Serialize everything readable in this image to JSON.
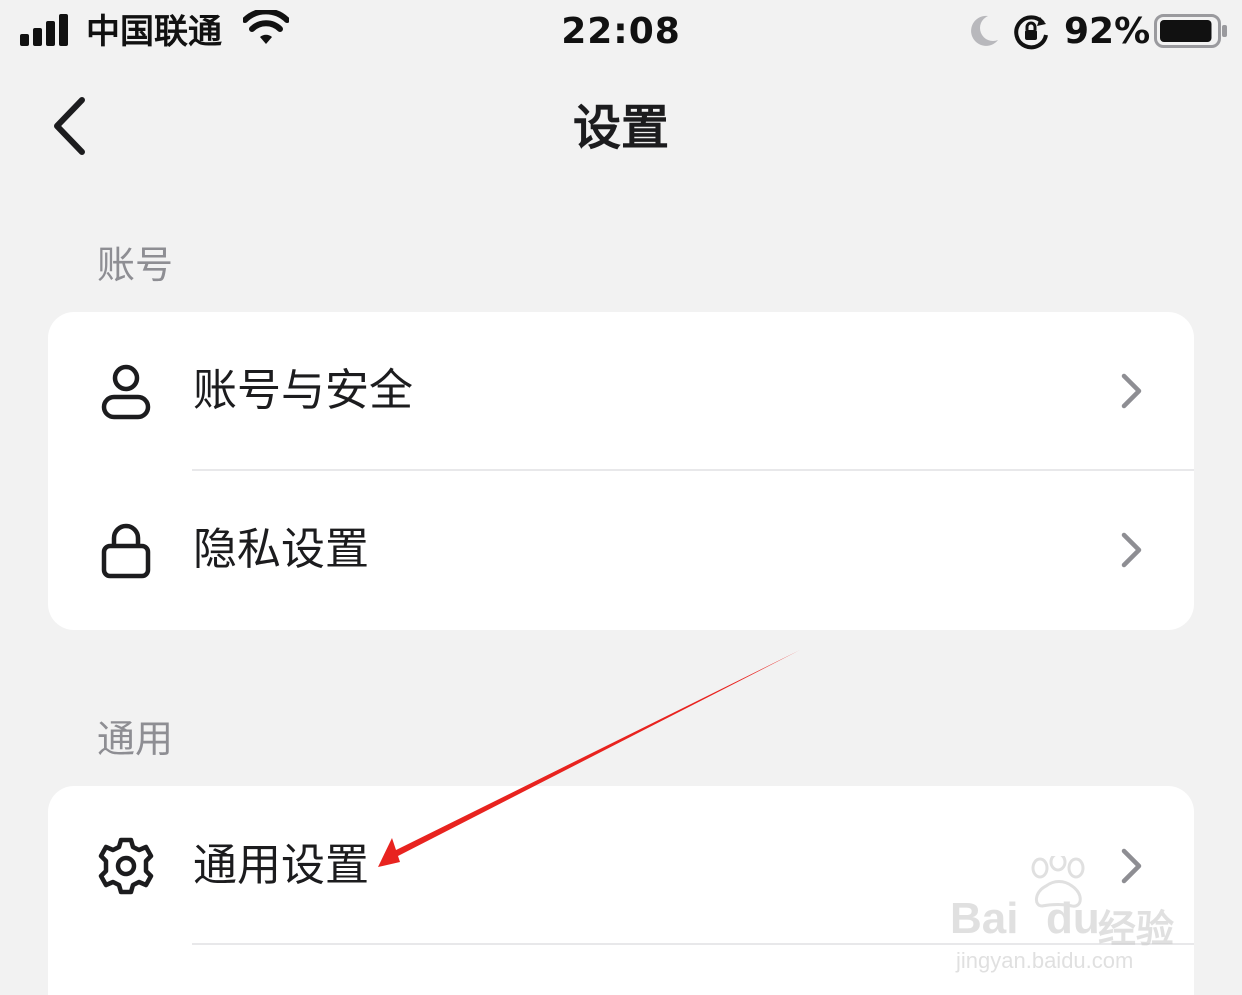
{
  "status_bar": {
    "carrier": "中国联通",
    "time": "22:08",
    "battery_percent": "92%",
    "battery_level": 0.92,
    "icons": [
      "signal-icon",
      "wifi-icon",
      "moon-icon",
      "rotation-lock-icon",
      "battery-icon"
    ]
  },
  "nav": {
    "title": "设置",
    "back_icon": "chevron-left-icon"
  },
  "sections": [
    {
      "header": "账号",
      "items": [
        {
          "label": "账号与安全",
          "icon": "user-icon"
        },
        {
          "label": "隐私设置",
          "icon": "lock-icon"
        }
      ]
    },
    {
      "header": "通用",
      "items": [
        {
          "label": "通用设置",
          "icon": "gear-icon"
        }
      ]
    }
  ],
  "annotation": {
    "color": "#e8231f",
    "target": "通用设置"
  },
  "watermark": {
    "brand_left": "Bai",
    "brand_right": "du",
    "brand_cn": "经验",
    "url": "jingyan.baidu.com"
  },
  "colors": {
    "background": "#f2f2f2",
    "card": "#ffffff",
    "section_header": "#8e8e93",
    "text": "#1c1c1e"
  }
}
